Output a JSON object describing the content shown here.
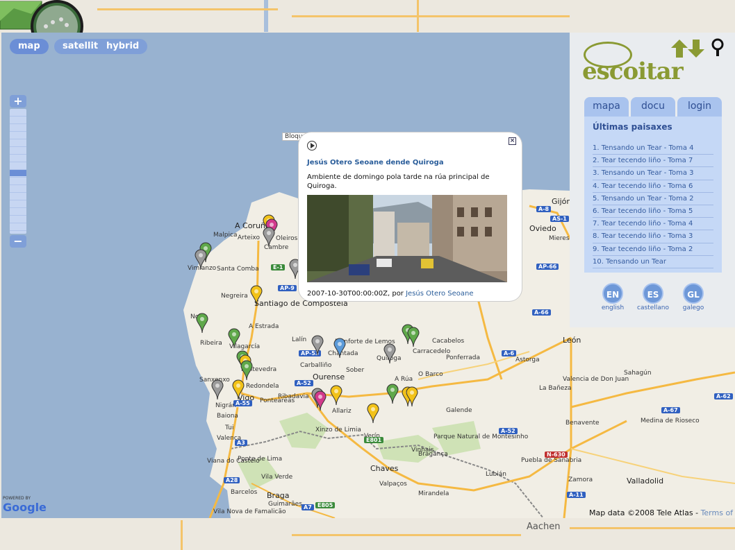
{
  "map_controls": {
    "types": [
      "map",
      "satellite",
      "hybrid"
    ],
    "zoom_in": "+",
    "zoom_out": "−"
  },
  "map_labels": {
    "bloquear": "Bloquear",
    "places": [
      "A Coruña",
      "Oleiros",
      "Cambre",
      "Arteixo",
      "Malpica",
      "Vimianzo",
      "Santa Comba",
      "Negreira",
      "Santiago de Compostela",
      "Noia",
      "Ribeira",
      "A Estrada",
      "Lalín",
      "Vilagarcía",
      "Pontevedra",
      "Sanxenxo",
      "Redondela",
      "Vigo",
      "Nigrán",
      "Baiona",
      "Ponteareas",
      "Ourense",
      "Allariz",
      "Xinzo de Limia",
      "Verín",
      "Viana do Castelo",
      "Ponte de Lima",
      "Braga",
      "Barcelos",
      "Guimarães",
      "Chaves",
      "Bragança",
      "Monforte de Lemos",
      "Quiroga",
      "Carracedelo",
      "Ponferrada",
      "Cacabelos",
      "A Rúa",
      "O Barco",
      "Oviedo",
      "Gijón",
      "León",
      "Astorga",
      "Benavente",
      "Valladolid",
      "Zamora",
      "Vila Nova de Famalicão",
      "Valença",
      "Vila Verde",
      "Tui",
      "Ribadavia",
      "Carballiño",
      "Sober",
      "Chantada",
      "Mieres",
      "La Bañeza",
      "Valencia de Don Juan",
      "Sahagún",
      "Medina de Rioseco",
      "Valpaços",
      "Mirandela",
      "Vinhais",
      "Parque Natural de Montesinho",
      "Puebla de Sanabria",
      "Lubián",
      "Galende"
    ],
    "highways": [
      "E-1",
      "AP-9",
      "AP-53",
      "A-52",
      "A-55",
      "A3",
      "A28",
      "A7",
      "E805",
      "E801",
      "AP-66",
      "A-66",
      "A-6",
      "A-8",
      "AS-1",
      "A-52",
      "N-630",
      "A-11",
      "A-67",
      "A-62"
    ]
  },
  "attribution": {
    "powered_by": "POWERED BY",
    "google": "Google",
    "map_data": "Map data ©2008 Tele Atlas - ",
    "terms": "Terms of Use"
  },
  "bubble": {
    "close": "×",
    "title": "Jesús Otero Seoane dende Quiroga",
    "description": "Ambiente de domingo pola tarde na rúa principal de Quiroga.",
    "meta_prefix": "2007-10-30T00:00:00Z, por ",
    "author": "Jesús Otero Seoane"
  },
  "sidebar": {
    "brand": "escoitar",
    "tabs": [
      "mapa",
      "docu",
      "login"
    ],
    "panel_title": "Últimas paisaxes",
    "items": [
      "1. Tensando un Tear - Toma 4",
      "2. Tear tecendo liño - Toma 7",
      "3. Tensando un Tear - Toma 3",
      "4. Tear tecendo liño - Toma 6",
      "5. Tensando un Tear - Toma 2",
      "6. Tear tecendo liño - Toma 5",
      "7. Tear tecendo liño - Toma 4",
      "8. Tear tecendo liño - Toma 3",
      "9. Tear tecendo liño - Toma 2",
      "10. Tensando un Tear"
    ],
    "languages": [
      {
        "code": "EN",
        "label": "english"
      },
      {
        "code": "ES",
        "label": "castellano"
      },
      {
        "code": "GL",
        "label": "galego"
      }
    ]
  },
  "background": {
    "city": "Aachen"
  },
  "colors": {
    "ocean": "#98b2d0",
    "land": "#f1eee5",
    "brand_green": "#8a9a33",
    "tab_blue": "#a9c3ee",
    "link_blue": "#2a5d9a",
    "pin_yellow": "#f2c219",
    "pin_green": "#5fa84a",
    "pin_gray": "#9a9a9a",
    "pin_magenta": "#d23a8c",
    "pin_blue": "#5b9ad8"
  }
}
